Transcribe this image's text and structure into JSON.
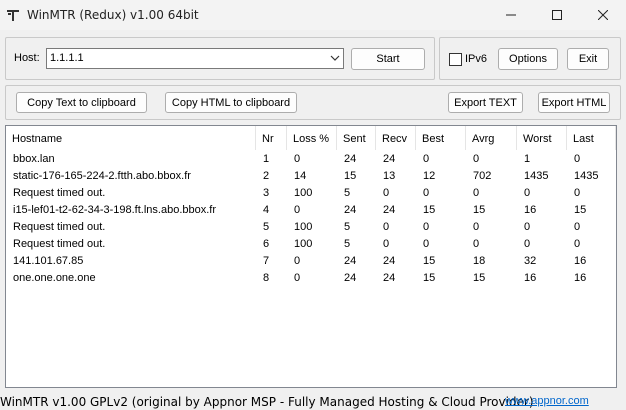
{
  "window": {
    "title": "WinMTR (Redux) v1.00 64bit",
    "icon": "pickaxe-icon"
  },
  "host_panel": {
    "host_label": "Host:",
    "host_value": "1.1.1.1",
    "start_label": "Start"
  },
  "options_panel": {
    "ipv6_label": "IPv6",
    "ipv6_checked": false,
    "options_label": "Options",
    "exit_label": "Exit"
  },
  "export_panel": {
    "copy_text_label": "Copy Text to clipboard",
    "copy_html_label": "Copy HTML to clipboard",
    "export_text_label": "Export TEXT",
    "export_html_label": "Export HTML"
  },
  "table": {
    "columns": [
      "Hostname",
      "Nr",
      "Loss %",
      "Sent",
      "Recv",
      "Best",
      "Avrg",
      "Worst",
      "Last"
    ],
    "rows": [
      [
        "bbox.lan",
        "1",
        "0",
        "24",
        "24",
        "0",
        "0",
        "1",
        "0"
      ],
      [
        "static-176-165-224-2.ftth.abo.bbox.fr",
        "2",
        "14",
        "15",
        "13",
        "12",
        "702",
        "1435",
        "1435"
      ],
      [
        "Request timed out.",
        "3",
        "100",
        "5",
        "0",
        "0",
        "0",
        "0",
        "0"
      ],
      [
        "i15-lef01-t2-62-34-3-198.ft.lns.abo.bbox.fr",
        "4",
        "0",
        "24",
        "24",
        "15",
        "15",
        "16",
        "15"
      ],
      [
        "Request timed out.",
        "5",
        "100",
        "5",
        "0",
        "0",
        "0",
        "0",
        "0"
      ],
      [
        "Request timed out.",
        "6",
        "100",
        "5",
        "0",
        "0",
        "0",
        "0",
        "0"
      ],
      [
        "141.101.67.85",
        "7",
        "0",
        "24",
        "24",
        "15",
        "18",
        "32",
        "16"
      ],
      [
        "one.one.one.one",
        "8",
        "0",
        "24",
        "24",
        "15",
        "15",
        "16",
        "16"
      ]
    ]
  },
  "status_bar": {
    "text": "WinMTR v1.00 GPLv2 (original by Appnor MSP - Fully Managed Hosting & Cloud Provider)",
    "link": "www.appnor.com"
  }
}
